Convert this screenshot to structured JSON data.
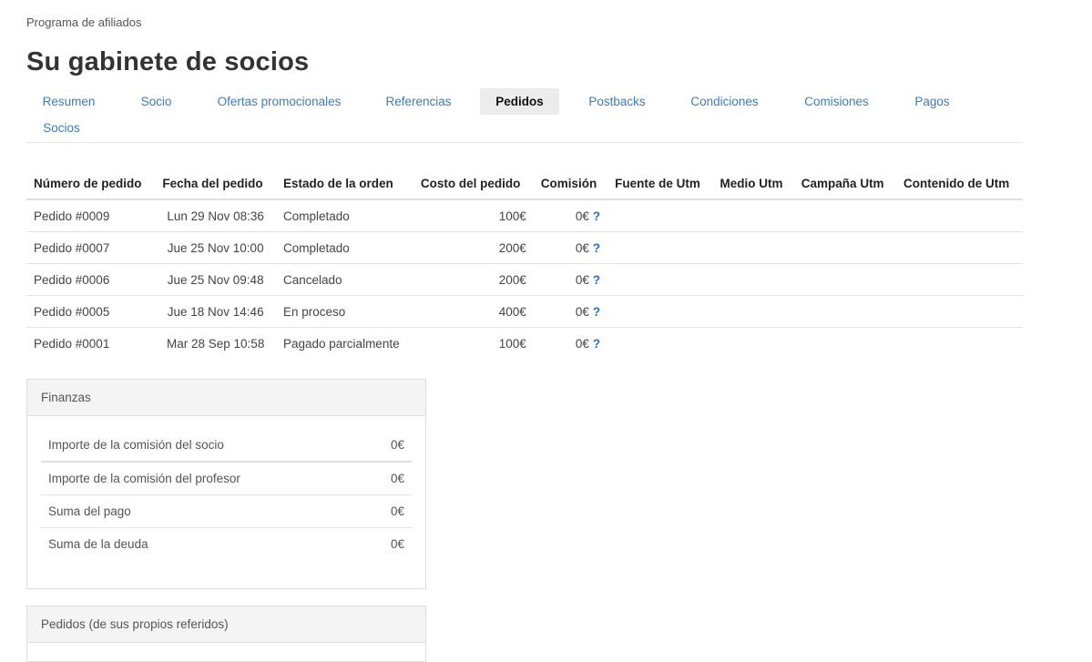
{
  "breadcrumb": "Programa de afiliados",
  "title": "Su gabinete de socios",
  "tabs": [
    {
      "label": "Resumen",
      "active": false
    },
    {
      "label": "Socio",
      "active": false
    },
    {
      "label": "Ofertas promocionales",
      "active": false
    },
    {
      "label": "Referencias",
      "active": false
    },
    {
      "label": "Pedidos",
      "active": true
    },
    {
      "label": "Postbacks",
      "active": false
    },
    {
      "label": "Condiciones",
      "active": false
    },
    {
      "label": "Comisiones",
      "active": false
    },
    {
      "label": "Pagos",
      "active": false
    },
    {
      "label": "Socios",
      "active": false
    }
  ],
  "orders": {
    "headers": [
      "Número de pedido",
      "Fecha del pedido",
      "Estado de la orden",
      "Costo del pedido",
      "Comisión",
      "Fuente de Utm",
      "Medio Utm",
      "Campaña Utm",
      "Contenido de Utm"
    ],
    "rows": [
      {
        "id": "Pedido #0009",
        "date": "Lun 29 Nov 08:36",
        "status": "Completado",
        "cost": "100€",
        "commission": "0€",
        "help": "?"
      },
      {
        "id": "Pedido #0007",
        "date": "Jue 25 Nov 10:00",
        "status": "Completado",
        "cost": "200€",
        "commission": "0€",
        "help": "?"
      },
      {
        "id": "Pedido #0006",
        "date": "Jue 25 Nov 09:48",
        "status": "Cancelado",
        "cost": "200€",
        "commission": "0€",
        "help": "?"
      },
      {
        "id": "Pedido #0005",
        "date": "Jue 18 Nov 14:46",
        "status": "En proceso",
        "cost": "400€",
        "commission": "0€",
        "help": "?"
      },
      {
        "id": "Pedido #0001",
        "date": "Mar 28 Sep 10:58",
        "status": "Pagado parcialmente",
        "cost": "100€",
        "commission": "0€",
        "help": "?"
      }
    ]
  },
  "finances": {
    "title": "Finanzas",
    "rows": [
      {
        "label": "Importe de la comisión del socio",
        "value": "0€"
      },
      {
        "label": "Importe de la comisión del profesor",
        "value": "0€"
      },
      {
        "label": "Suma del pago",
        "value": "0€"
      },
      {
        "label": "Suma de la deuda",
        "value": "0€"
      }
    ]
  },
  "referred_orders": {
    "title": "Pedidos (de sus propios referidos)"
  },
  "colors": {
    "link": "#3d7cbf",
    "active_tab_bg": "#ececec",
    "panel_header_bg": "#f4f4f4",
    "help_icon": "#2a6cbf"
  }
}
